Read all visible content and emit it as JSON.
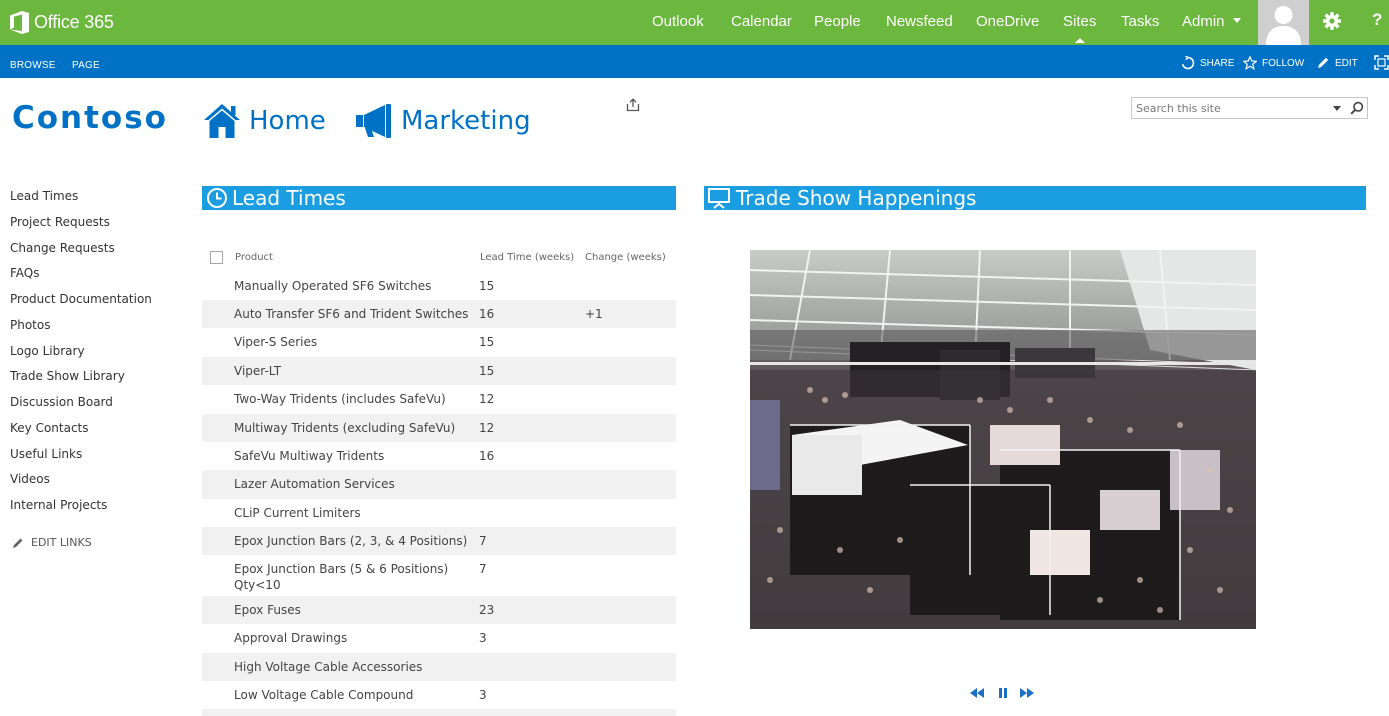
{
  "suite_bar": {
    "brand": "Office 365",
    "links": [
      {
        "label": "Outlook"
      },
      {
        "label": "Calendar"
      },
      {
        "label": "People"
      },
      {
        "label": "Newsfeed"
      },
      {
        "label": "OneDrive"
      },
      {
        "label": "Sites",
        "active": true
      },
      {
        "label": "Tasks"
      },
      {
        "label": "Admin"
      }
    ],
    "help_label": "?",
    "bar_color": "#6cb83f"
  },
  "ribbon": {
    "tabs": [
      "BROWSE",
      "PAGE"
    ],
    "actions": {
      "share": "SHARE",
      "follow": "FOLLOW",
      "edit": "EDIT"
    },
    "bar_color": "#0072c6"
  },
  "site": {
    "logo_text": "Contoso",
    "top_nav": [
      {
        "label": "Home",
        "icon": "home-icon"
      },
      {
        "label": "Marketing",
        "icon": "megaphone-icon"
      }
    ],
    "search_placeholder": "Search this site"
  },
  "quick_launch": {
    "items": [
      "Lead Times",
      "Project Requests",
      "Change Requests",
      "FAQs",
      "Product Documentation",
      "Photos",
      "Logo Library",
      "Trade Show Library",
      "Discussion Board",
      "Key Contacts",
      "Useful Links",
      "Videos",
      "Internal Projects"
    ],
    "edit_links": "EDIT LINKS"
  },
  "lead_times": {
    "title": "Lead Times",
    "columns": {
      "product": "Product",
      "lead": "Lead Time (weeks)",
      "change": "Change (weeks)"
    },
    "rows": [
      {
        "product": "Manually Operated SF6 Switches",
        "lead": "15",
        "change": ""
      },
      {
        "product": "Auto Transfer SF6 and Trident Switches",
        "lead": "16",
        "change": "+1"
      },
      {
        "product": "Viper-S Series",
        "lead": "15",
        "change": ""
      },
      {
        "product": "Viper-LT",
        "lead": "15",
        "change": ""
      },
      {
        "product": "Two-Way Tridents (includes SafeVu)",
        "lead": "12",
        "change": ""
      },
      {
        "product": "Multiway Tridents (excluding SafeVu)",
        "lead": "12",
        "change": ""
      },
      {
        "product": "SafeVu Multiway Tridents",
        "lead": "16",
        "change": ""
      },
      {
        "product": "Lazer Automation Services",
        "lead": "",
        "change": ""
      },
      {
        "product": "CLiP Current Limiters",
        "lead": "",
        "change": ""
      },
      {
        "product": "Epox Junction Bars (2, 3, & 4 Positions)",
        "lead": "7",
        "change": ""
      },
      {
        "product": "Epox Junction Bars (5 & 6 Positions) Qty<10",
        "lead": "7",
        "change": ""
      },
      {
        "product": "Epox Fuses",
        "lead": "23",
        "change": ""
      },
      {
        "product": "Approval Drawings",
        "lead": "3",
        "change": ""
      },
      {
        "product": "High Voltage Cable Accessories",
        "lead": "",
        "change": ""
      },
      {
        "product": "Low Voltage Cable Compound",
        "lead": "3",
        "change": ""
      }
    ]
  },
  "trade_show": {
    "title": "Trade Show Happenings"
  },
  "colors": {
    "accent_blue": "#0072c6",
    "title_bar_blue": "#1b9de2",
    "row_stripe": "#f1f1f1"
  }
}
